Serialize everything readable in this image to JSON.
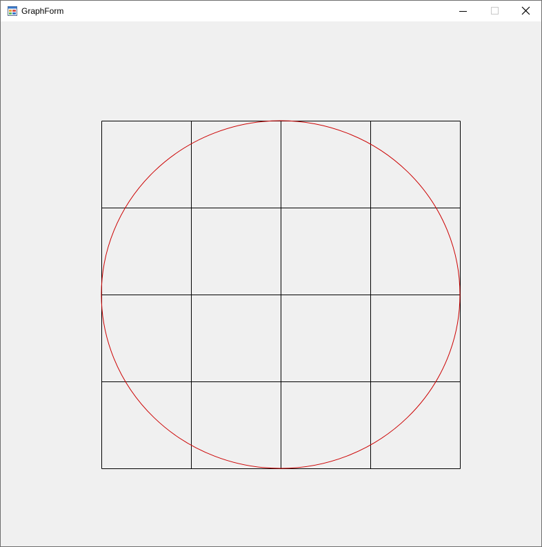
{
  "window": {
    "title": "GraphForm",
    "icon": "form-app-icon"
  },
  "controls": {
    "minimize_icon": "minimize-icon",
    "maximize_icon": "maximize-icon",
    "close_icon": "close-icon"
  },
  "graph": {
    "grid": {
      "rows": 4,
      "columns": 4,
      "color": "#000000"
    },
    "circle": {
      "color": "#cc0000",
      "inscribed": true
    }
  }
}
